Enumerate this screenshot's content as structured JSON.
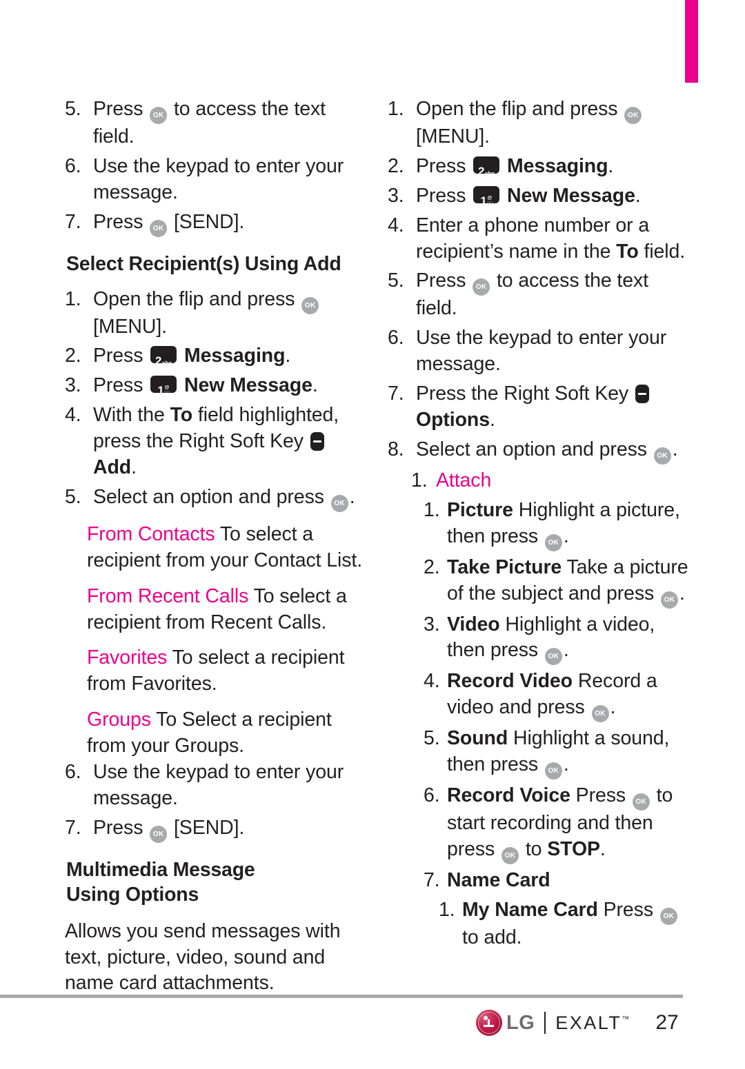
{
  "theme": {
    "accent_pink": "#ec008c",
    "text": "#231f20",
    "key_ok_bg": "#a7a9ac",
    "key_dark_bg": "#231f20",
    "rule": "#a6a8ab",
    "lg_red": "#c01a45"
  },
  "left_column": {
    "items": [
      {
        "id": "l1",
        "level": 1,
        "num": "5.",
        "parts": [
          {
            "t": "Press "
          },
          {
            "icon": "ok-key-icon"
          },
          {
            "t": " to access the text field."
          }
        ]
      },
      {
        "id": "l2",
        "level": 1,
        "num": "6.",
        "parts": [
          {
            "t": "Use the keypad to enter your message."
          }
        ]
      },
      {
        "id": "l3",
        "level": 1,
        "num": "7.",
        "parts": [
          {
            "t": "Press "
          },
          {
            "icon": "ok-key-icon"
          },
          {
            "t": " [SEND]."
          }
        ]
      }
    ],
    "heading_1": "Select Recipient(s) Using Add",
    "items_2": [
      {
        "id": "l4",
        "level": 1,
        "num": "1.",
        "parts": [
          {
            "t": "Open the flip and press "
          },
          {
            "icon": "ok-key-icon"
          },
          {
            "t": " [MENU]."
          }
        ]
      },
      {
        "id": "l5",
        "level": 1,
        "num": "2.",
        "parts": [
          {
            "t": "Press "
          },
          {
            "icon": "key-2-abc-icon"
          },
          {
            "t": " ",
            "style": "none"
          },
          {
            "t": "Messaging",
            "style": "bold"
          },
          {
            "t": "."
          }
        ]
      },
      {
        "id": "l6",
        "level": 1,
        "num": "3.",
        "parts": [
          {
            "t": "Press "
          },
          {
            "icon": "key-1-icon"
          },
          {
            "t": " "
          },
          {
            "t": "New Message",
            "style": "bold"
          },
          {
            "t": "."
          }
        ]
      },
      {
        "id": "l7",
        "level": 1,
        "num": "4.",
        "parts": [
          {
            "t": "With the "
          },
          {
            "t": "To",
            "style": "bold"
          },
          {
            "t": " field highlighted, press the Right Soft Key "
          },
          {
            "icon": "right-soft-key-icon"
          },
          {
            "t": " "
          },
          {
            "t": "Add",
            "style": "bold"
          },
          {
            "t": "."
          }
        ]
      },
      {
        "id": "l8",
        "level": 1,
        "num": "5.",
        "parts": [
          {
            "t": "Select an option and press "
          },
          {
            "icon": "ok-key-icon"
          },
          {
            "t": "."
          }
        ]
      }
    ],
    "options": [
      {
        "id": "o1",
        "label": "From Contacts",
        "desc": " To select a recipient from your Contact List."
      },
      {
        "id": "o2",
        "label": "From Recent Calls",
        "desc": " To select a recipient from Recent Calls."
      },
      {
        "id": "o3",
        "label": "Favorites",
        "desc": " To select a recipient from Favorites."
      },
      {
        "id": "o4",
        "label": "Groups",
        "desc": " To Select a recipient from your Groups."
      }
    ],
    "items_3": [
      {
        "id": "l9",
        "level": 1,
        "num": "6.",
        "parts": [
          {
            "t": "Use the keypad to enter your message."
          }
        ]
      },
      {
        "id": "l10",
        "level": 1,
        "num": "7.",
        "parts": [
          {
            "t": "Press "
          },
          {
            "icon": "ok-key-icon"
          },
          {
            "t": " [SEND]."
          }
        ]
      }
    ],
    "heading_2_line1": "Multimedia Message",
    "heading_2_line2": "Using Options",
    "paragraph": "Allows you send messages with text, picture, video, sound and name card attachments."
  },
  "right_column": {
    "items": [
      {
        "id": "r1",
        "level": 1,
        "num": "1.",
        "parts": [
          {
            "t": "Open the flip and press "
          },
          {
            "icon": "ok-key-icon"
          },
          {
            "t": " [MENU]."
          }
        ]
      },
      {
        "id": "r2",
        "level": 1,
        "num": "2.",
        "parts": [
          {
            "t": "Press "
          },
          {
            "icon": "key-2-abc-icon"
          },
          {
            "t": " "
          },
          {
            "t": "Messaging",
            "style": "bold"
          },
          {
            "t": "."
          }
        ]
      },
      {
        "id": "r3",
        "level": 1,
        "num": "3.",
        "parts": [
          {
            "t": "Press "
          },
          {
            "icon": "key-1-icon"
          },
          {
            "t": " "
          },
          {
            "t": "New Message",
            "style": "bold"
          },
          {
            "t": "."
          }
        ]
      },
      {
        "id": "r4",
        "level": 1,
        "num": "4.",
        "parts": [
          {
            "t": "Enter a phone number or a recipient’s name in the "
          },
          {
            "t": "To",
            "style": "bold"
          },
          {
            "t": " field."
          }
        ]
      },
      {
        "id": "r5",
        "level": 1,
        "num": "5.",
        "parts": [
          {
            "t": "Press "
          },
          {
            "icon": "ok-key-icon"
          },
          {
            "t": " to access the text field."
          }
        ]
      },
      {
        "id": "r6",
        "level": 1,
        "num": "6.",
        "parts": [
          {
            "t": "Use the keypad to enter your message."
          }
        ]
      },
      {
        "id": "r7",
        "level": 1,
        "num": "7.",
        "parts": [
          {
            "t": "Press the Right Soft Key "
          },
          {
            "icon": "right-soft-key-icon"
          },
          {
            "t": " "
          },
          {
            "t": "Options",
            "style": "bold"
          },
          {
            "t": "."
          }
        ]
      },
      {
        "id": "r8",
        "level": 1,
        "num": "8.",
        "parts": [
          {
            "t": "Select an option and press "
          },
          {
            "icon": "ok-key-icon"
          },
          {
            "t": "."
          }
        ]
      }
    ],
    "attach": {
      "num": "1.",
      "label": "Attach"
    },
    "attach_items": [
      {
        "id": "a1",
        "num": "1.",
        "parts": [
          {
            "t": "Picture",
            "style": "bold"
          },
          {
            "t": " Highlight a picture, then press "
          },
          {
            "icon": "ok-key-icon"
          },
          {
            "t": "."
          }
        ]
      },
      {
        "id": "a2",
        "num": "2.",
        "parts": [
          {
            "t": "Take Picture",
            "style": "bold"
          },
          {
            "t": " Take a picture of the subject and press "
          },
          {
            "icon": "ok-key-icon"
          },
          {
            "t": "."
          }
        ]
      },
      {
        "id": "a3",
        "num": "3.",
        "parts": [
          {
            "t": "Video",
            "style": "bold"
          },
          {
            "t": " Highlight a video, then press "
          },
          {
            "icon": "ok-key-icon"
          },
          {
            "t": "."
          }
        ]
      },
      {
        "id": "a4",
        "num": "4.",
        "parts": [
          {
            "t": "Record Video",
            "style": "bold"
          },
          {
            "t": " Record a video and press "
          },
          {
            "icon": "ok-key-icon"
          },
          {
            "t": "."
          }
        ]
      },
      {
        "id": "a5",
        "num": "5.",
        "parts": [
          {
            "t": "Sound",
            "style": "bold"
          },
          {
            "t": " Highlight a sound, then press "
          },
          {
            "icon": "ok-key-icon"
          },
          {
            "t": "."
          }
        ]
      },
      {
        "id": "a6",
        "num": "6.",
        "parts": [
          {
            "t": "Record Voice",
            "style": "bold"
          },
          {
            "t": " Press "
          },
          {
            "icon": "ok-key-icon"
          },
          {
            "t": " to start recording and then press "
          },
          {
            "icon": "ok-key-icon"
          },
          {
            "t": " to "
          },
          {
            "t": "STOP",
            "style": "bold"
          },
          {
            "t": "."
          }
        ]
      },
      {
        "id": "a7",
        "num": "7.",
        "parts": [
          {
            "t": "Name Card",
            "style": "bold"
          }
        ]
      }
    ],
    "name_card_sub": [
      {
        "id": "n1",
        "num": "1.",
        "parts": [
          {
            "t": "My Name Card",
            "style": "bold"
          },
          {
            "t": " Press "
          },
          {
            "icon": "ok-key-icon"
          },
          {
            "t": " to add."
          }
        ]
      }
    ]
  },
  "footer": {
    "brand": "LG",
    "product": "EXALT",
    "trademark": "™",
    "page_number": "27"
  },
  "icons": {
    "ok-key-icon": {
      "kind": "ok",
      "label": "OK"
    },
    "key-2-abc-icon": {
      "kind": "numkey",
      "digit": "2",
      "sub": "abc"
    },
    "key-1-icon": {
      "kind": "numkey",
      "digit": "1",
      "sub": "@"
    },
    "right-soft-key-icon": {
      "kind": "softkey"
    }
  }
}
